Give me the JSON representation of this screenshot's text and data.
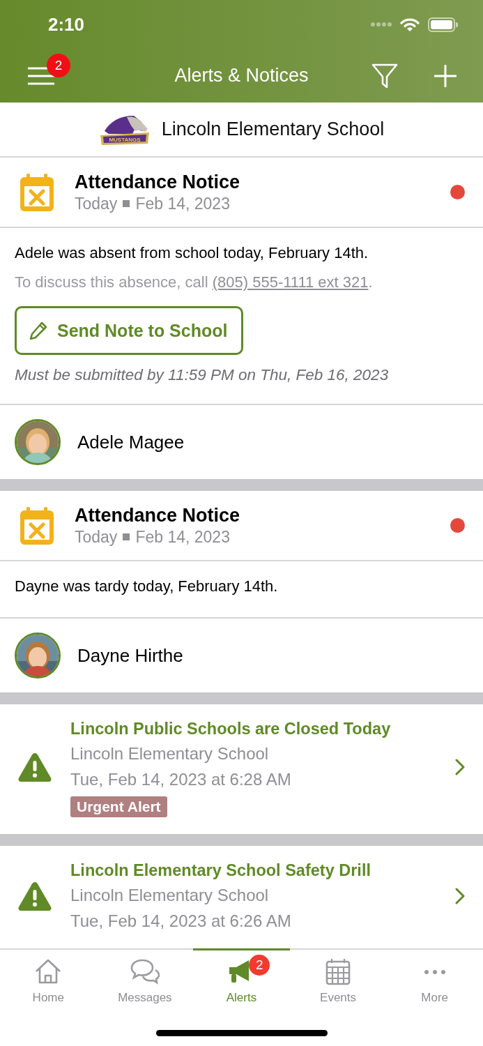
{
  "status_bar": {
    "time": "2:10"
  },
  "nav": {
    "title": "Alerts & Notices",
    "menu_badge": "2"
  },
  "school": {
    "name": "Lincoln Elementary School",
    "logo_text": "MUSTANGS"
  },
  "feed": [
    {
      "kind": "notice",
      "title": "Attendance Notice",
      "day": "Today",
      "date": "Feb 14, 2023",
      "unread": true,
      "message": "Adele was absent from school today, February 14th.",
      "contact_text": "To discuss this absence, call ",
      "phone": "(805) 555-1111 ext 321",
      "contact_end": ".",
      "button": "Send Note to School",
      "deadline": "Must be submitted by 11:59 PM on Thu, Feb 16, 2023",
      "student": "Adele Magee"
    },
    {
      "kind": "notice",
      "title": "Attendance Notice",
      "day": "Today",
      "date": "Feb 14, 2023",
      "unread": true,
      "message": "Dayne was tardy today, February 14th.",
      "student": "Dayne Hirthe"
    },
    {
      "kind": "alert",
      "title": "Lincoln Public Schools are Closed Today",
      "source": "Lincoln Elementary School",
      "time": "Tue, Feb 14, 2023 at 6:28 AM",
      "tag": "Urgent Alert"
    },
    {
      "kind": "alert",
      "title": "Lincoln Elementary School Safety Drill",
      "source": "Lincoln Elementary School",
      "time": "Tue, Feb 14, 2023 at 6:26 AM"
    }
  ],
  "tabs": [
    {
      "label": "Home",
      "selected": false
    },
    {
      "label": "Messages",
      "selected": false
    },
    {
      "label": "Alerts",
      "selected": true,
      "badge": "2"
    },
    {
      "label": "Events",
      "selected": false
    },
    {
      "label": "More",
      "selected": false
    }
  ]
}
